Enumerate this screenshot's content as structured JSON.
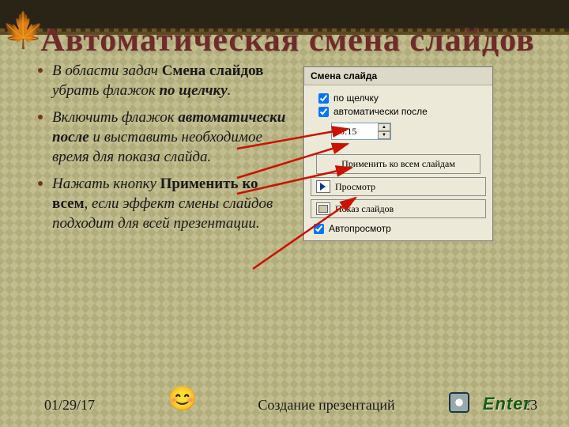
{
  "title": "Автоматическая смена слайдов",
  "bullets": [
    {
      "pre": "В области задач ",
      "b1": "Смена слайдов",
      "mid": "  убрать флажок ",
      "b2": "по щелчку",
      "post": "."
    },
    {
      "pre": "Включить флажок ",
      "b1": "автоматически после",
      "mid": " и выставить необходимое время для показа слайда.",
      "b2": "",
      "post": ""
    },
    {
      "pre": "Нажать кнопку ",
      "b1": "Применить ко всем",
      "mid": ", если эффект смены слайдов подходит для всей презентации.",
      "b2": "",
      "post": ""
    }
  ],
  "panel": {
    "header": "Смена слайда",
    "chk_click": "по щелчку",
    "chk_auto": "автоматически после",
    "time_value": "00:15",
    "apply_all": "Применить ко всем слайдам",
    "preview": "Просмотр",
    "slideshow": "Показ слайдов",
    "autopreview": "Автопросмотр"
  },
  "footer": {
    "date": "01/29/17",
    "source": "Создание презентаций",
    "page": "23"
  },
  "enter_label": "Enter"
}
